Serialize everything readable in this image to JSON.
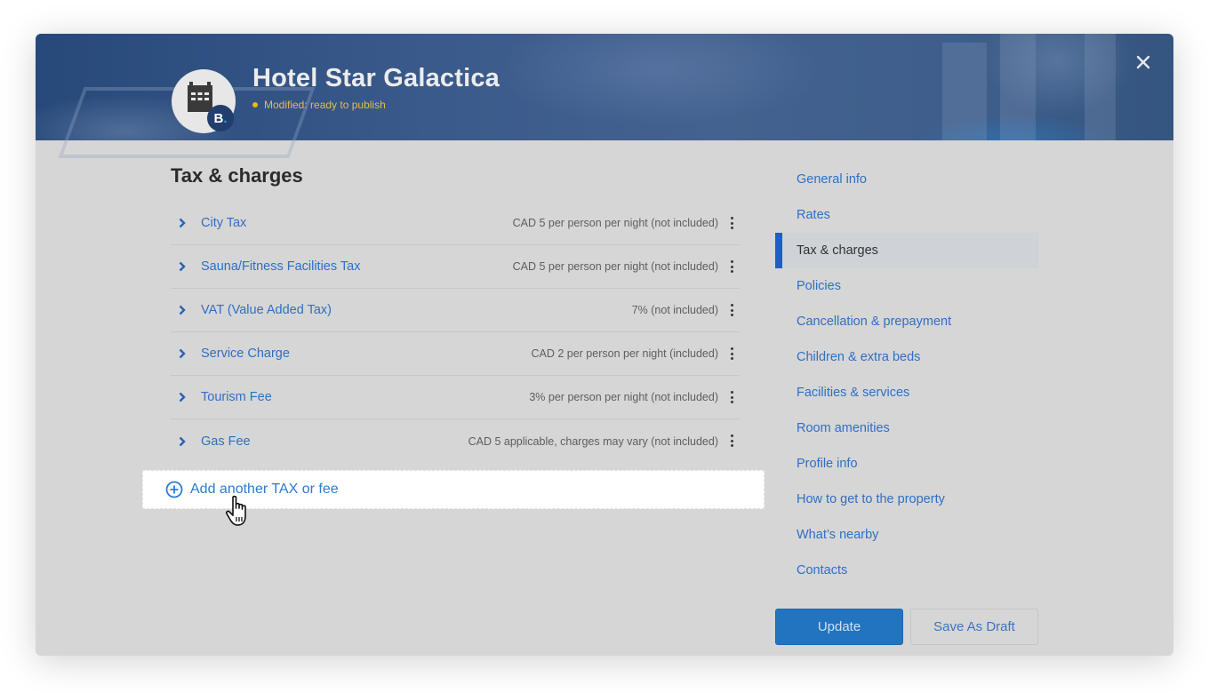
{
  "header": {
    "hotel_name": "Hotel Star Galactica",
    "status_text": "Modified: ready to publish",
    "brand_badge": "B",
    "brand_badge_dot": ".",
    "close_icon": "close-icon"
  },
  "main": {
    "section_title": "Tax & charges",
    "taxes": [
      {
        "name": "City Tax",
        "value": "CAD 5 per person per night (not included)"
      },
      {
        "name": "Sauna/Fitness Facilities Tax",
        "value": "CAD 5 per person per night (not included)"
      },
      {
        "name": "VAT (Value Added Tax)",
        "value": "7% (not included)"
      },
      {
        "name": "Service Charge",
        "value": "CAD 2 per person per night (included)"
      },
      {
        "name": "Tourism Fee",
        "value": "3% per person per night (not included)"
      },
      {
        "name": "Gas Fee",
        "value": "CAD 5 applicable, charges may vary (not included)"
      }
    ],
    "add_label": "Add another TAX or fee"
  },
  "side_nav": {
    "items": [
      {
        "label": "General info",
        "active": false
      },
      {
        "label": "Rates",
        "active": false
      },
      {
        "label": "Tax & charges",
        "active": true
      },
      {
        "label": "Policies",
        "active": false
      },
      {
        "label": "Cancellation & prepayment",
        "active": false
      },
      {
        "label": "Children & extra beds",
        "active": false
      },
      {
        "label": "Facilities & services",
        "active": false
      },
      {
        "label": "Room amenities",
        "active": false
      },
      {
        "label": "Profile info",
        "active": false
      },
      {
        "label": "How to get to the property",
        "active": false
      },
      {
        "label": "What’s nearby",
        "active": false
      },
      {
        "label": "Contacts",
        "active": false
      }
    ]
  },
  "actions": {
    "update_label": "Update",
    "draft_label": "Save As Draft"
  },
  "colors": {
    "accent": "#2274c0",
    "link": "#2f6fc4",
    "status_dot": "#f1b419",
    "header_bg": "#3a5a8c"
  }
}
